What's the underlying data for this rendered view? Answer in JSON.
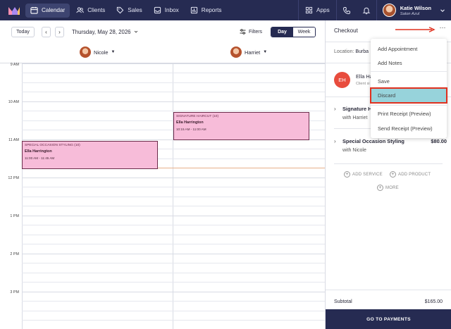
{
  "nav": {
    "items": [
      {
        "label": "Calendar",
        "icon": "calendar-icon",
        "active": true
      },
      {
        "label": "Clients",
        "icon": "clients-icon"
      },
      {
        "label": "Sales",
        "icon": "tag-icon"
      },
      {
        "label": "Inbox",
        "icon": "inbox-icon"
      },
      {
        "label": "Reports",
        "icon": "bar-chart-icon"
      }
    ],
    "apps_label": "Apps",
    "user": {
      "name": "Katie Wilson",
      "business": "Salon Azul"
    }
  },
  "toolbar": {
    "today": "Today",
    "prev": "‹",
    "next": "›",
    "date": "Thursday, May 28, 2026",
    "filters": "Filters",
    "views": {
      "day": "Day",
      "week": "Week"
    }
  },
  "staff": [
    {
      "name": "Nicole"
    },
    {
      "name": "Harriet"
    }
  ],
  "time_labels": [
    "9 AM",
    "10 AM",
    "11 AM",
    "12 PM",
    "1 PM",
    "2 PM",
    "3 PM"
  ],
  "appointments": [
    {
      "service": "SPECIAL OCCASION STYLING",
      "code": "(10)",
      "client": "Ella Harrington",
      "time": "11:00 AM - 11:45 AM"
    },
    {
      "service": "SIGNATURE HAIRCUT",
      "code": "(10)",
      "client": "Ella Harrington",
      "time": "10:15 AM - 11:00 AM"
    }
  ],
  "checkout": {
    "title": "Checkout",
    "more": "···",
    "location_label": "Location:",
    "location_value": "Burba",
    "client_initials": "EH",
    "client_name": "Ella Ha",
    "client_sub": "Client si",
    "services": [
      {
        "name": "Signature H",
        "staff": "with Harriet",
        "price": ""
      },
      {
        "name": "Special Occasion Styling",
        "staff": "with Nicole",
        "price": "$80.00"
      }
    ],
    "add_service": "ADD SERVICE",
    "add_product": "ADD PRODUCT",
    "more_link": "MORE",
    "subtotal_label": "Subtotal",
    "subtotal_value": "$165.00",
    "pay_button": "GO TO PAYMENTS"
  },
  "menu": {
    "items": [
      "Add Appointment",
      "Add Notes",
      "Save",
      "Discard",
      "Print Receipt (Preview)",
      "Send Receipt (Preview)"
    ],
    "highlighted": "Discard"
  },
  "colors": {
    "nav_bg": "#262b52",
    "appt_bg": "#f7bcd9",
    "highlight": "#97d3db",
    "callout": "#e0301e",
    "avatar_red": "#e84c3d"
  }
}
